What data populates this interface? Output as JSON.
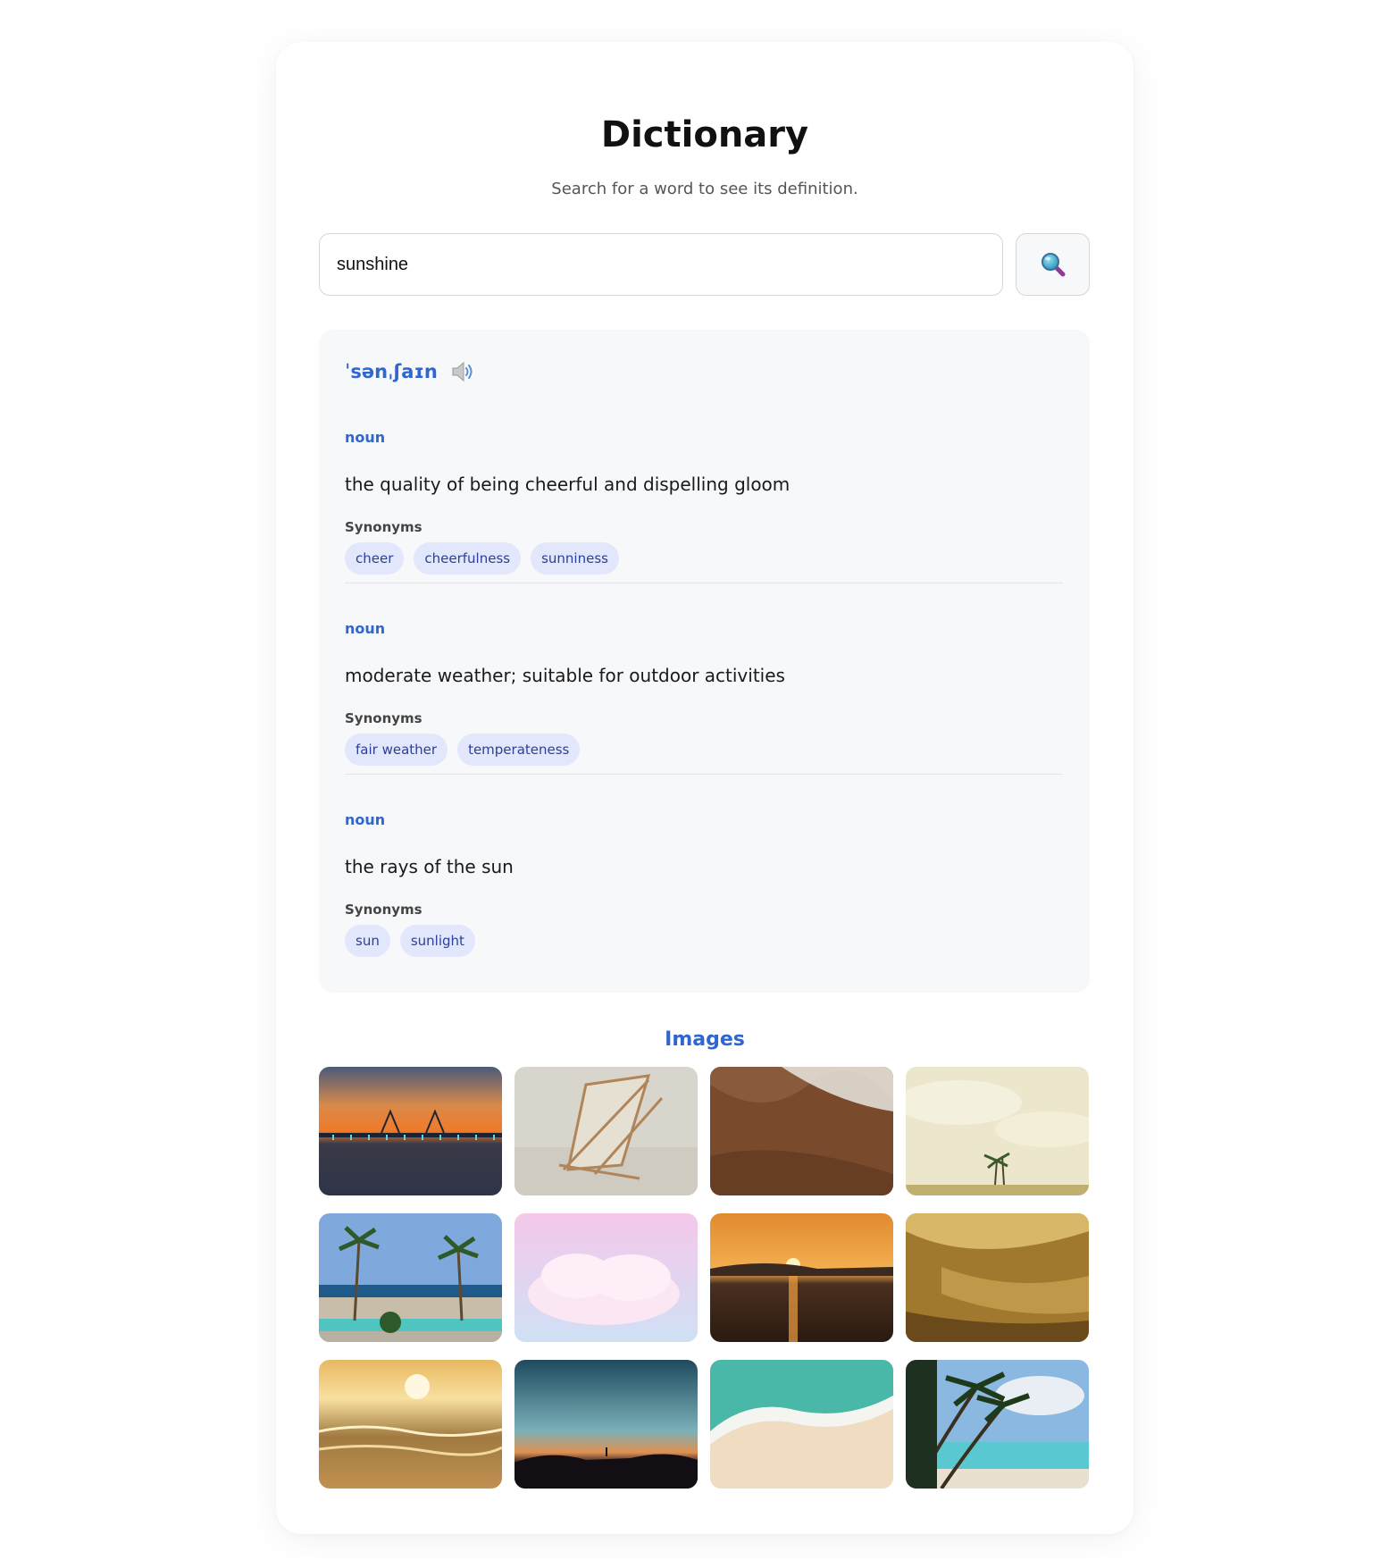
{
  "header": {
    "title": "Dictionary",
    "subtitle": "Search for a word to see its definition."
  },
  "search": {
    "value": "sunshine",
    "button_icon": "magnifying-glass-icon"
  },
  "entry": {
    "phonetic": "ˈsənˌʃaɪn",
    "audio_icon": "speaker-icon",
    "synonyms_label": "Synonyms",
    "senses": [
      {
        "part_of_speech": "noun",
        "definition": "the quality of being cheerful and dispelling gloom",
        "synonyms": [
          "cheer",
          "cheerfulness",
          "sunniness"
        ]
      },
      {
        "part_of_speech": "noun",
        "definition": "moderate weather; suitable for outdoor activities",
        "synonyms": [
          "fair weather",
          "temperateness"
        ]
      },
      {
        "part_of_speech": "noun",
        "definition": "the rays of the sun",
        "synonyms": [
          "sun",
          "sunlight"
        ]
      }
    ]
  },
  "images": {
    "heading": "Images",
    "items": [
      "sunset-bridge-image",
      "beach-chair-image",
      "ocean-wave-foam-image",
      "palm-tree-cloudy-sky-image",
      "palm-trees-resort-image",
      "pink-cloud-image",
      "sunset-over-sea-image",
      "golden-sand-wave-image",
      "sunlit-waves-image",
      "dusk-silhouette-image",
      "aerial-beach-waves-image",
      "tropical-palms-image"
    ]
  },
  "colors": {
    "accent": "#2f66d0",
    "chip_bg": "#e3e7fb",
    "chip_text": "#2c3f9a",
    "panel_bg": "#f7f8fa"
  }
}
